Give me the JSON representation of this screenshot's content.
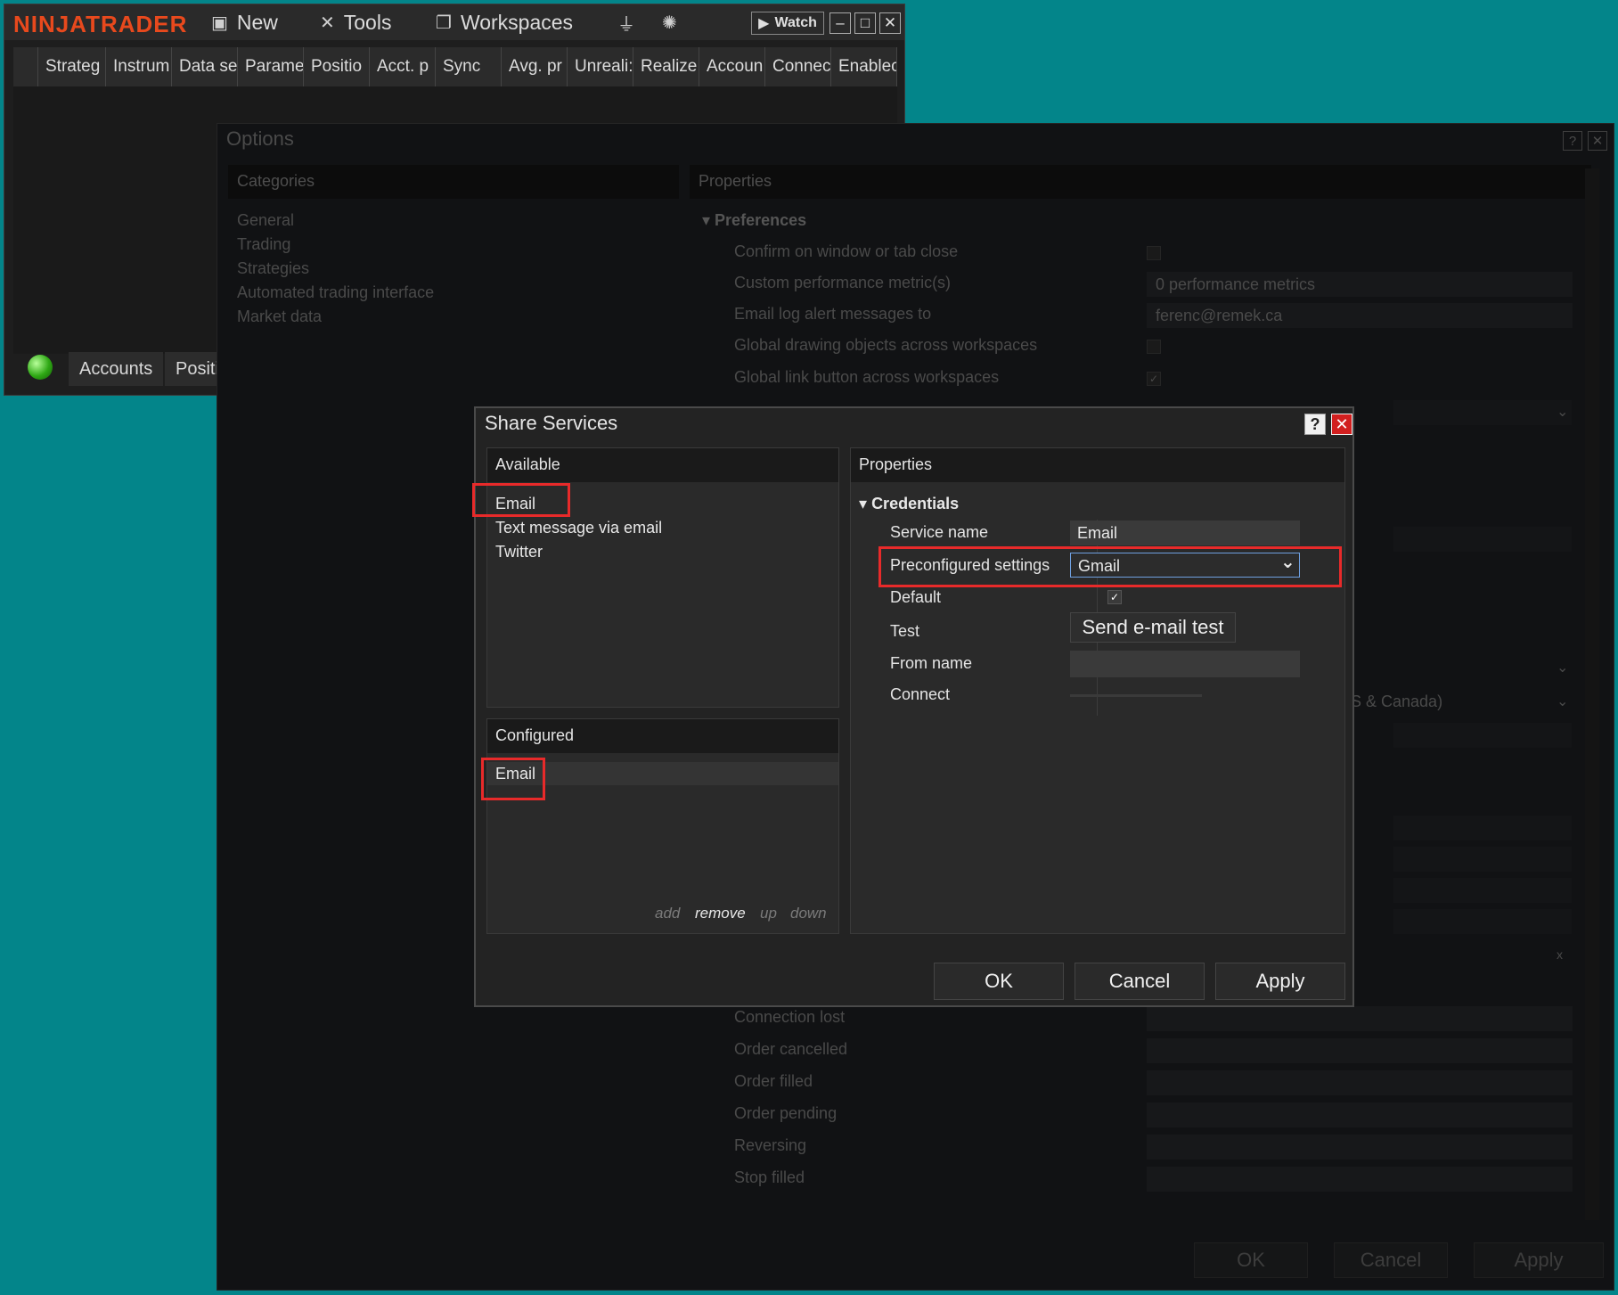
{
  "control_center": {
    "logo": "NINJATRADER",
    "menu": [
      {
        "icon": "new-window-icon",
        "label": "New"
      },
      {
        "icon": "tools-icon",
        "label": "Tools"
      },
      {
        "icon": "workspaces-icon",
        "label": "Workspaces"
      }
    ],
    "watch_label": "Watch",
    "grid_columns": [
      "Strateg",
      "Instrum",
      "Data se",
      "Parame",
      "Positio",
      "Acct. p",
      "Sync",
      "Avg. pr",
      "Unreali:",
      "Realize",
      "Accoun",
      "Connec",
      "Enablec"
    ],
    "tabs": [
      "Accounts",
      "Positi"
    ]
  },
  "options": {
    "title": "Options",
    "categories_header": "Categories",
    "categories": [
      "General",
      "Trading",
      "Strategies",
      "Automated trading interface",
      "Market data"
    ],
    "properties_header": "Properties",
    "group": "Preferences",
    "rows": [
      {
        "label": "Confirm on window or tab close",
        "value": ""
      },
      {
        "label": "Custom performance metric(s)",
        "value": "0 performance metrics"
      },
      {
        "label": "Email log alert messages to",
        "value": "ferenc@remek.ca"
      },
      {
        "label": "Global drawing objects across workspaces",
        "value": ""
      },
      {
        "label": "Global link button across workspaces",
        "value": "✓"
      }
    ],
    "partial_value": "S & Canada)",
    "sound_rows": [
      "Connection lost",
      "Order cancelled",
      "Order filled",
      "Order pending",
      "Reversing",
      "Stop filled"
    ],
    "buttons": {
      "ok": "OK",
      "cancel": "Cancel",
      "apply": "Apply"
    }
  },
  "share_services": {
    "title": "Share Services",
    "available_header": "Available",
    "available": [
      "Email",
      "Text message via email",
      "Twitter"
    ],
    "configured_header": "Configured",
    "configured": [
      "Email"
    ],
    "actions": [
      "add",
      "remove",
      "up",
      "down"
    ],
    "properties_header": "Properties",
    "group": "Credentials",
    "properties": {
      "service_name_label": "Service name",
      "service_name_value": "Email",
      "preconfigured_label": "Preconfigured settings",
      "preconfigured_value": "Gmail",
      "default_label": "Default",
      "default_checked": true,
      "test_label": "Test",
      "test_button": "Send e-mail test",
      "from_name_label": "From name",
      "from_name_value": "",
      "connect_label": "Connect"
    },
    "buttons": {
      "ok": "OK",
      "cancel": "Cancel",
      "apply": "Apply"
    },
    "highlight_color": "#e82a2a"
  }
}
